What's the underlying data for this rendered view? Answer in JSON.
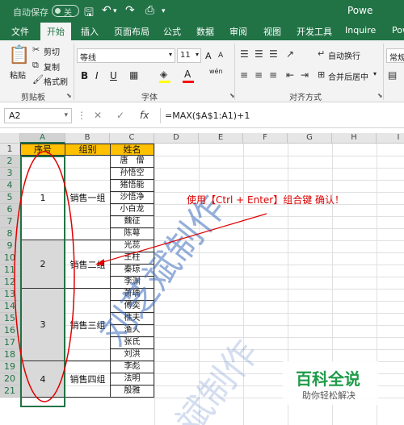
{
  "titlebar": {
    "autosave_label": "自动保存",
    "autosave_state": "关",
    "save_icon": "save-icon",
    "undo_icon": "undo-icon",
    "redo_icon": "redo-icon",
    "preview_icon": "print-preview-icon",
    "doc_title": "Powe"
  },
  "tabs": [
    "文件",
    "开始",
    "插入",
    "页面布局",
    "公式",
    "数据",
    "审阅",
    "视图",
    "开发工具",
    "Inquire",
    "Powe"
  ],
  "active_tab": "开始",
  "ribbon": {
    "clipboard": {
      "paste": "粘贴",
      "cut": "剪切",
      "copy": "复制",
      "format_painter": "格式刷",
      "group_label": "剪贴板"
    },
    "font": {
      "name": "等线",
      "size": "11",
      "bold": "B",
      "italic": "I",
      "underline": "U",
      "grow": "A",
      "shrink": "A",
      "wen": "wén",
      "group_label": "字体"
    },
    "alignment": {
      "wrap": "自动换行",
      "merge": "合并后居中",
      "group_label": "对齐方式"
    },
    "number": {
      "format": "常规"
    }
  },
  "formula_bar": {
    "name_box": "A2",
    "cancel": "✕",
    "enter": "✓",
    "fx": "fx",
    "formula": "=MAX($A$1:A1)+1"
  },
  "sheet": {
    "columns": [
      "A",
      "B",
      "C",
      "D",
      "E",
      "F",
      "G",
      "H",
      "I"
    ],
    "rows": [
      "1",
      "2",
      "3",
      "4",
      "5",
      "6",
      "7",
      "8",
      "9",
      "10",
      "11",
      "12",
      "13",
      "14",
      "15",
      "16",
      "17",
      "18",
      "19",
      "20",
      "21"
    ],
    "headers": {
      "a": "序号",
      "b": "组别",
      "c": "姓名"
    },
    "groups": [
      {
        "num": "1",
        "name": "销售一组"
      },
      {
        "num": "2",
        "name": "销售二组"
      },
      {
        "num": "3",
        "name": "销售三组"
      },
      {
        "num": "4",
        "name": "销售四组"
      }
    ],
    "names": [
      "唐　僧",
      "孙悟空",
      "猪悟能",
      "沙悟净",
      "小白龙",
      "魏征",
      "陈萼",
      "光蕊",
      "王柱",
      "秦琼",
      "李渊",
      "萧瑀",
      "傅奕",
      "樵夫",
      "渔人",
      "张氏",
      "刘洪",
      "李彪",
      "法明",
      "殷雅",
      "",
      ""
    ]
  },
  "annotation": "使用【Ctrl + Enter】组合键 确认！",
  "watermark": "刘芝斌制作",
  "watermark_reflection": "斌制作",
  "badge": {
    "title": "百科全说",
    "subtitle": "助你轻松解决"
  }
}
